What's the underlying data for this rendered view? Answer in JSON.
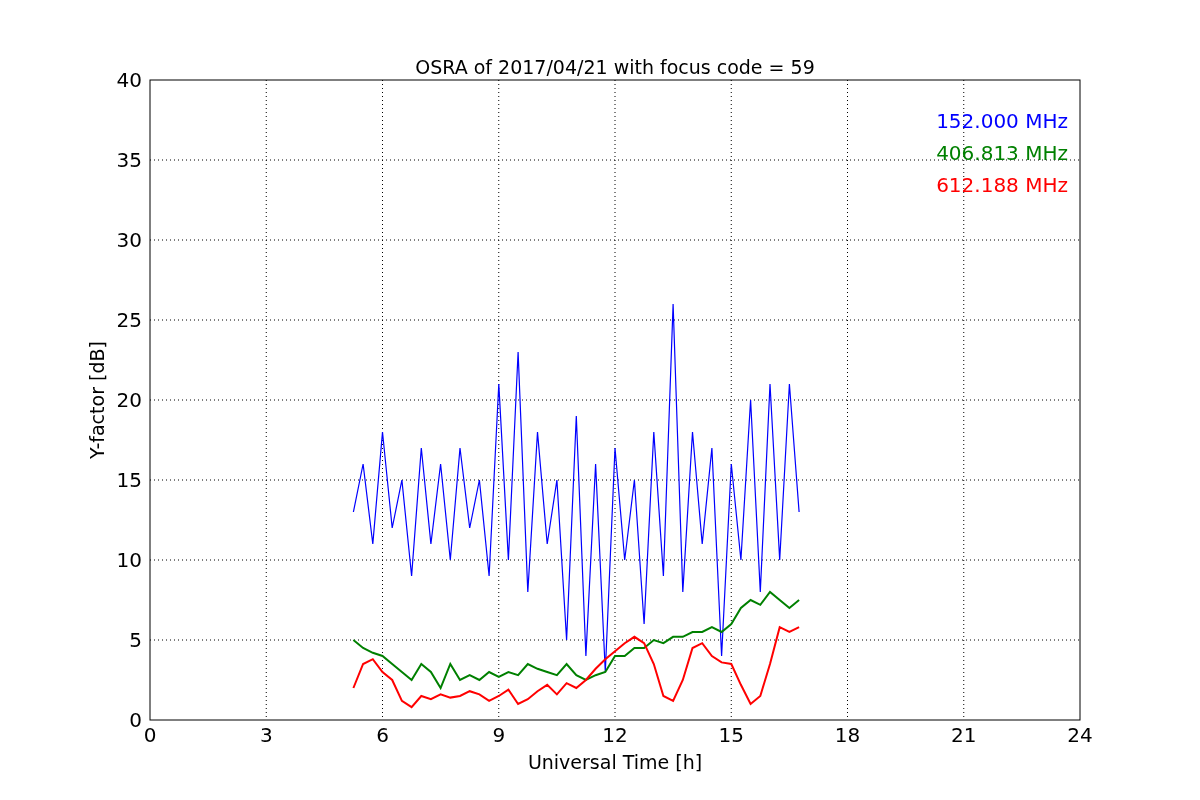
{
  "chart_data": {
    "type": "line",
    "title": "OSRA of 2017/04/21 with focus code = 59",
    "xlabel": "Universal Time [h]",
    "ylabel": "Y-factor [dB]",
    "x": [
      5.25,
      5.5,
      5.75,
      6,
      6.25,
      6.5,
      6.75,
      7,
      7.25,
      7.5,
      7.75,
      8,
      8.25,
      8.5,
      8.75,
      9,
      9.25,
      9.5,
      9.75,
      10,
      10.25,
      10.5,
      10.75,
      11,
      11.25,
      11.5,
      11.75,
      12,
      12.25,
      12.5,
      12.75,
      13,
      13.25,
      13.5,
      13.75,
      14,
      14.25,
      14.5,
      14.75,
      15,
      15.25,
      15.5,
      15.75,
      16,
      16.25,
      16.5,
      16.75
    ],
    "series": [
      {
        "name": "152.000 MHz",
        "color": "#0000ff",
        "values": [
          13,
          16,
          11,
          18,
          12,
          15,
          9,
          17,
          11,
          16,
          10,
          17,
          12,
          15,
          9,
          21,
          10,
          23,
          8,
          18,
          11,
          15,
          5,
          19,
          4,
          16,
          3,
          17,
          10,
          15,
          6,
          18,
          9,
          26,
          8,
          18,
          11,
          17,
          4,
          16,
          10,
          20,
          8,
          21,
          10,
          21,
          13
        ]
      },
      {
        "name": "406.813 MHz",
        "color": "#008000",
        "values": [
          5,
          4.5,
          4.2,
          4,
          3.5,
          3,
          2.5,
          3.5,
          3,
          2,
          3.5,
          2.5,
          2.8,
          2.5,
          3,
          2.7,
          3,
          2.8,
          3.5,
          3.2,
          3,
          2.8,
          3.5,
          2.8,
          2.5,
          2.8,
          3,
          4,
          4,
          4.5,
          4.5,
          5,
          4.8,
          5.2,
          5.2,
          5.5,
          5.5,
          5.8,
          5.5,
          6,
          7,
          7.5,
          7.2,
          8,
          7.5,
          7,
          7.5
        ]
      },
      {
        "name": "612.188 MHz",
        "color": "#ff0000",
        "values": [
          2,
          3.5,
          3.8,
          3,
          2.5,
          1.2,
          0.8,
          1.5,
          1.3,
          1.6,
          1.4,
          1.5,
          1.8,
          1.6,
          1.2,
          1.5,
          1.9,
          1,
          1.3,
          1.8,
          2.2,
          1.6,
          2.3,
          2,
          2.5,
          3.2,
          3.8,
          4.3,
          4.8,
          5.2,
          4.8,
          3.5,
          1.5,
          1.2,
          2.5,
          4.5,
          4.8,
          4,
          3.6,
          3.5,
          2.2,
          1,
          1.5,
          3.5,
          5.8,
          5.5,
          5.8
        ]
      }
    ],
    "grid": true,
    "xlim": [
      0,
      24
    ],
    "ylim": [
      0,
      40
    ],
    "xticks": [
      0,
      3,
      6,
      9,
      12,
      15,
      18,
      21,
      24
    ],
    "yticks": [
      0,
      5,
      10,
      15,
      20,
      25,
      30,
      35,
      40
    ]
  }
}
